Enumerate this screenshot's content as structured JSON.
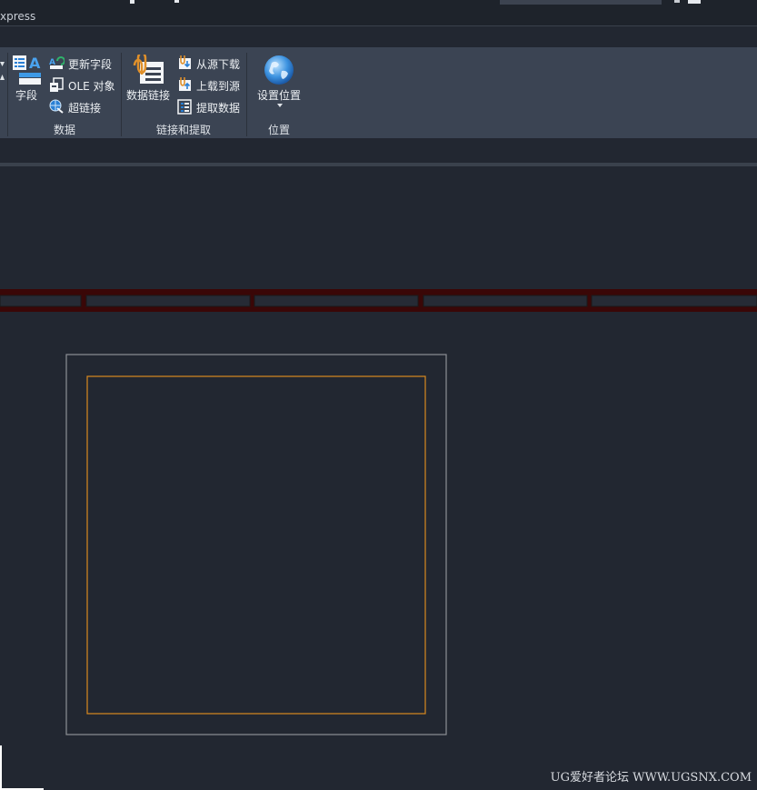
{
  "titlebar": {
    "tab_label": "xpress"
  },
  "ribbon": {
    "panels": [
      {
        "title": "数据",
        "large_button": "字段",
        "small_buttons": [
          "更新字段",
          "OLE 对象",
          "超链接"
        ]
      },
      {
        "title": "链接和提取",
        "large_button": "数据链接",
        "small_buttons": [
          "从源下载",
          "上载到源",
          "提取数据"
        ]
      },
      {
        "title": "位置",
        "large_button": "设置位置"
      }
    ]
  },
  "watermark": "UG爱好者论坛 WWW.UGSNX.COM",
  "colors": {
    "background": "#222731",
    "ribbon": "#3b4453",
    "accent_orange": "#d98a1e",
    "frame_gray": "#8c8f95",
    "hatch_red": "#4a0a0a"
  }
}
